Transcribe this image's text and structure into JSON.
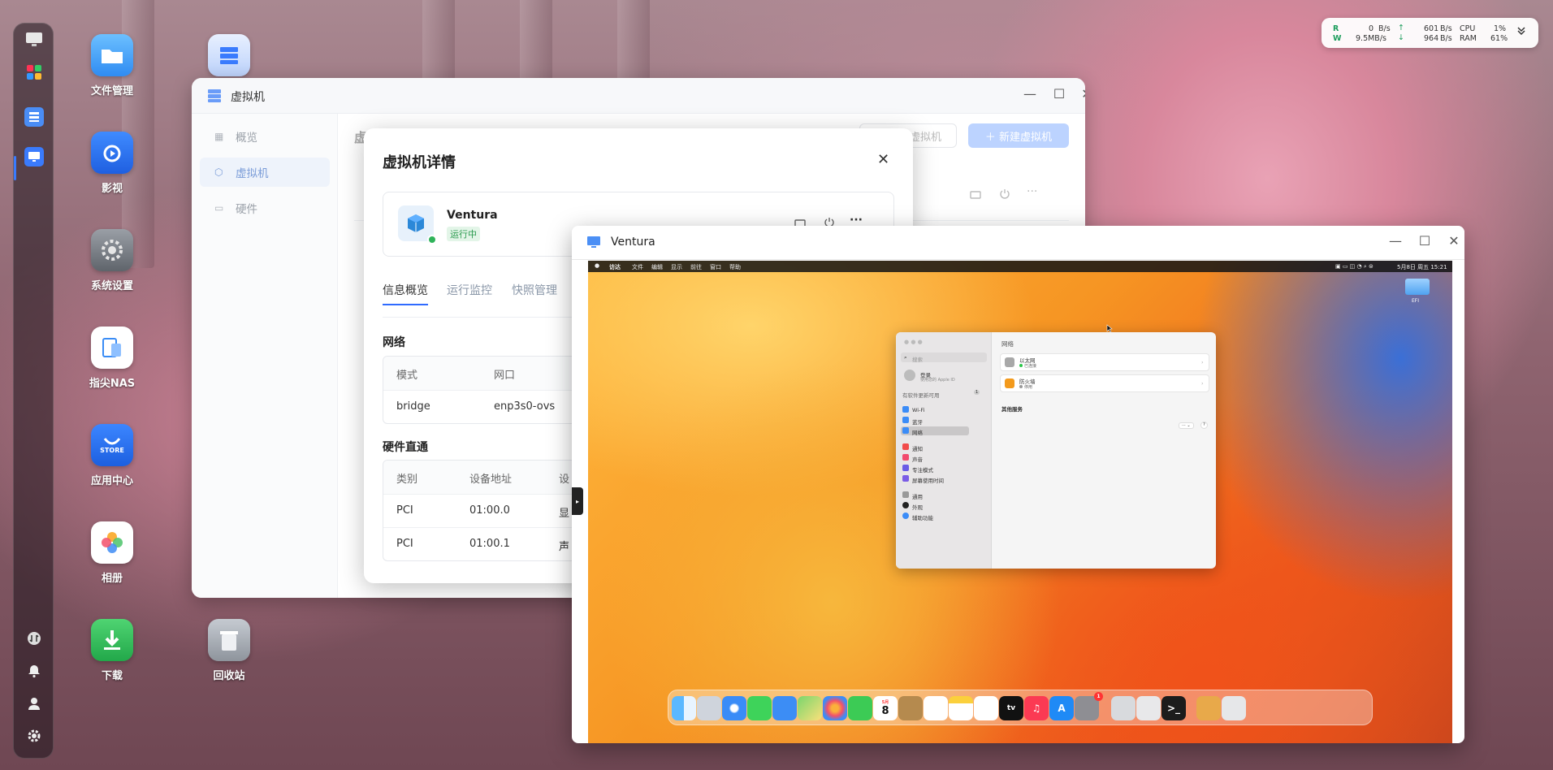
{
  "desktop": {
    "icons": [
      {
        "name": "文件管理",
        "color": "#3fa3ff"
      },
      {
        "name": "影视",
        "color": "#2f7cf6"
      },
      {
        "name": "系统设置",
        "color": "#7a7f86"
      },
      {
        "name": "指尖NAS",
        "color": "#ffffff"
      },
      {
        "name": "应用中心",
        "color": "#2a6fe8"
      },
      {
        "name": "相册",
        "color": "#ffffff"
      },
      {
        "name": "下载",
        "color": "#35c35b"
      },
      {
        "name": "回收站",
        "color": "#aab0b8"
      }
    ]
  },
  "monitor": {
    "r_label": "R",
    "w_label": "W",
    "r_down": "0",
    "r_down_unit": "B/s",
    "w_down": "9.5MB/s",
    "up_arrow": "↑",
    "down_arrow": "↓",
    "r_up": "601",
    "r_up_unit": "B/s",
    "w_up": "964",
    "w_up_unit": "B/s",
    "cpu_label": "CPU",
    "cpu": "1%",
    "ram_label": "RAM",
    "ram": "61%"
  },
  "vm_window": {
    "title": "虚拟机",
    "sidebar": [
      "概览",
      "虚拟机",
      "硬件"
    ],
    "header_partial": "虚",
    "btn_import": "虚拟机",
    "btn_new": "＋ 新建虚拟机"
  },
  "detail": {
    "title": "虚拟机详情",
    "vm_name": "Ventura",
    "status": "运行中",
    "tabs": [
      "信息概览",
      "运行监控",
      "快照管理"
    ],
    "network": {
      "title": "网络",
      "headers": [
        "模式",
        "网口"
      ],
      "rows": [
        [
          "bridge",
          "enp3s0-ovs"
        ]
      ]
    },
    "passthrough": {
      "title": "硬件直通",
      "headers": [
        "类别",
        "设备地址",
        "设"
      ],
      "rows": [
        [
          "PCI",
          "01:00.0",
          "显"
        ],
        [
          "PCI",
          "01:00.1",
          "声"
        ]
      ]
    }
  },
  "ventura": {
    "title": "Ventura",
    "menubar": [
      "访达",
      "文件",
      "编辑",
      "显示",
      "前往",
      "窗口",
      "帮助"
    ],
    "clock": "5月8日 周五 15:21",
    "desktop_item": "EFI",
    "settings": {
      "search": "搜索",
      "account_title": "登录",
      "account_sub": "使用您的 Apple ID",
      "update": "有软件更新可用",
      "update_badge": "1",
      "side_items": [
        "Wi-Fi",
        "蓝牙",
        "网络",
        "通知",
        "声音",
        "专注模式",
        "屏幕使用时间",
        "通用",
        "外观",
        "辅助功能"
      ],
      "main_title": "网络",
      "ethernet": "以太网",
      "ethernet_status": "已连接",
      "firewall": "防火墙",
      "firewall_status": "停用",
      "other": "其他服务",
      "more": "··· ⌄",
      "help": "?"
    },
    "dock": {
      "calendar_month": "5月",
      "calendar_day": "8",
      "settings_badge": "1",
      "tv_label": "tv"
    }
  }
}
